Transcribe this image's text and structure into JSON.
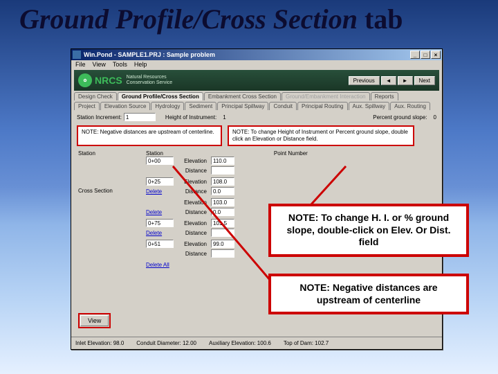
{
  "slide": {
    "title_italic": "Ground Profile/Cross Section",
    "title_plain": " tab"
  },
  "window": {
    "title": "Win.Pond - SAMPLE1.PRJ : Sample problem",
    "menu": [
      "File",
      "View",
      "Tools",
      "Help"
    ],
    "banner": {
      "org": "NRCS",
      "sub1": "Natural Resources",
      "sub2": "Conservation Service"
    },
    "nav": {
      "prev": "Previous",
      "next": "Next",
      "left": "◄",
      "right": "►"
    },
    "tab_rows": {
      "row1": [
        "Design Check",
        "Ground Profile/Cross Section",
        "Embankment Cross Section",
        "Ground/Embankment Interaction",
        "Reports"
      ],
      "row2": [
        "Project",
        "Elevation Source",
        "Hydrology",
        "Sediment",
        "Principal Spillway",
        "Conduit",
        "Principal Routing",
        "Aux. Spillway",
        "Aux. Routing"
      ]
    },
    "active_tab": "Ground Profile/Cross Section",
    "top_fields": {
      "station_increment_label": "Station Increment:",
      "station_increment": "1",
      "height_instrument_label": "Height of Instrument:",
      "height_instrument": "1",
      "percent_slope_label": "Percent ground slope:",
      "percent_slope": "0"
    },
    "notes": {
      "left": "NOTE: Negative distances are upstream of centerline.",
      "right": "NOTE: To change Height of Instrument or Percent ground slope, double click an Elevation or Distance field."
    },
    "section_labels": {
      "station": "Station",
      "cross_section": "Cross Section",
      "point_number": "Point Number"
    },
    "row_labels": {
      "elevation": "Elevation",
      "distance": "Distance"
    },
    "rows": [
      {
        "station": "0+00",
        "elev": "110.0",
        "dist": ""
      },
      {
        "station": "0+25",
        "elev": "108.0",
        "dist": "0.0"
      },
      {
        "station": "",
        "elev": "103.0",
        "dist": "0.0"
      },
      {
        "station": "0+75",
        "elev": "101.5",
        "dist": ""
      },
      {
        "station": "0+51",
        "elev": "99.0",
        "dist": ""
      }
    ],
    "delete": "Delete",
    "delete_all": "Delete All",
    "view_btn": "View",
    "status": {
      "inlet": "Inlet Elevation: 98.0",
      "conduit": "Conduit Diameter: 12.00",
      "aux": "Auxiliary Elevation: 100.6",
      "top": "Top of Dam: 102.7"
    }
  },
  "callouts": {
    "a": "NOTE: To change H. I. or % ground slope, double-click on Elev. Or Dist. field",
    "b": "NOTE: Negative distances are upstream of centerline"
  }
}
